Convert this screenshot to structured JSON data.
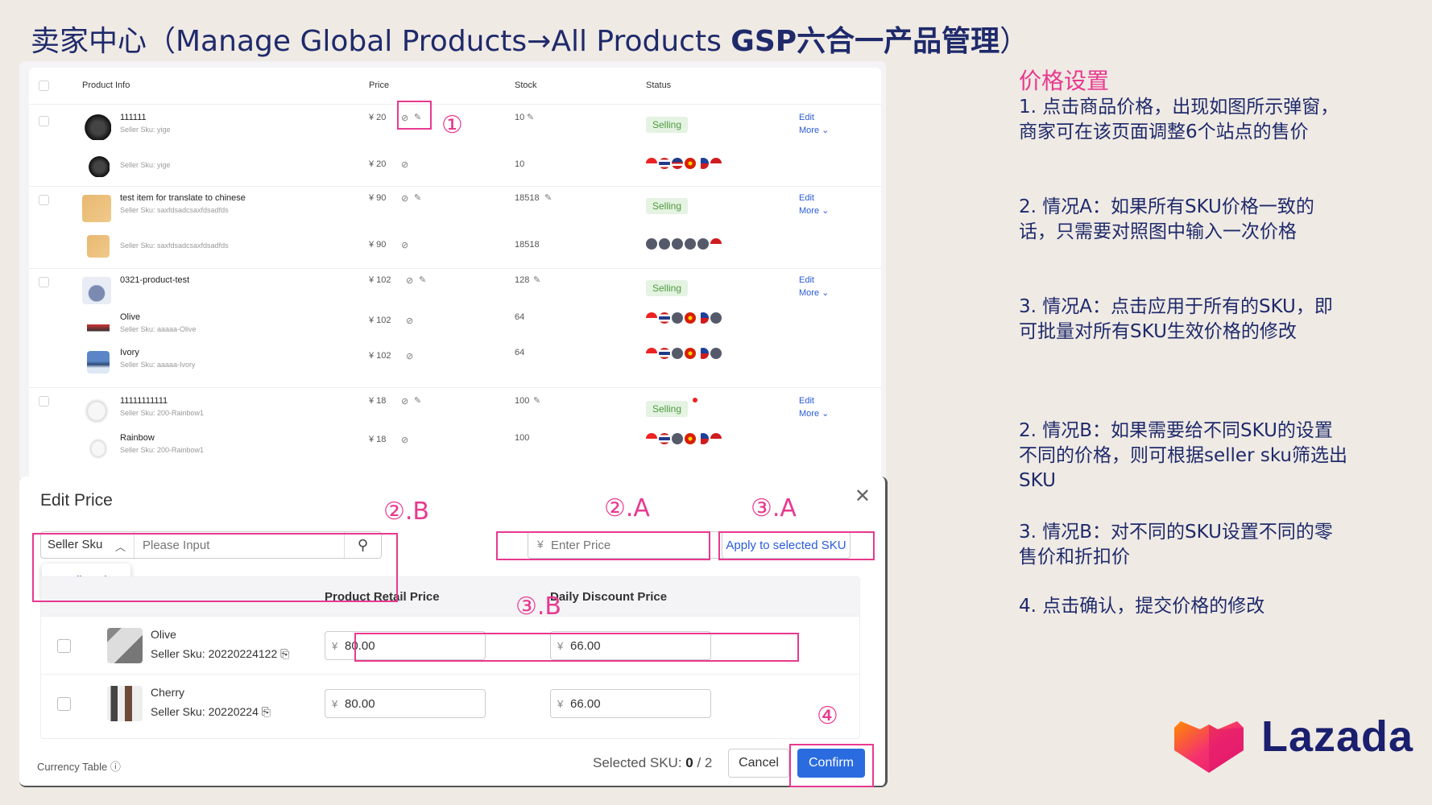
{
  "title": {
    "prefix": "卖家中心（Manage Global Products→All Products ",
    "bold": "GSP六合一产品管理",
    "suffix": "）"
  },
  "list": {
    "headers": [
      "Product Info",
      "Price",
      "Stock",
      "Status"
    ],
    "groups": [
      {
        "main": {
          "name": "111111",
          "sku": "Seller Sku: yige",
          "price": "¥ 20",
          "stock": "10",
          "status": "Selling",
          "edit": "Edit",
          "more": "More"
        },
        "variants": [
          {
            "name": "",
            "sku": "Seller Sku: yige",
            "price": "¥ 20",
            "stock": "10"
          }
        ]
      },
      {
        "main": {
          "name": "test item for translate to chinese",
          "sku": "Seller Sku: saxfdsadcsaxfdsadfds",
          "price": "¥ 90",
          "stock": "18518",
          "status": "Selling",
          "edit": "Edit",
          "more": "More"
        },
        "variants": [
          {
            "name": "",
            "sku": "Seller Sku: saxfdsadcsaxfdsadfds",
            "price": "¥ 90",
            "stock": "18518"
          }
        ]
      },
      {
        "main": {
          "name": "0321-product-test",
          "sku": "",
          "price": "¥ 102",
          "stock": "128",
          "status": "Selling",
          "edit": "Edit",
          "more": "More"
        },
        "variants": [
          {
            "name": "Olive",
            "sku": "Seller Sku: aaaaa-Olive",
            "price": "¥ 102",
            "stock": "64"
          },
          {
            "name": "Ivory",
            "sku": "Seller Sku: aaaaa-Ivory",
            "price": "¥ 102",
            "stock": "64"
          }
        ]
      },
      {
        "main": {
          "name": "11111111111",
          "sku": "Seller Sku: 200-Rainbow1",
          "price": "¥ 18",
          "stock": "100",
          "status": "Selling",
          "edit": "Edit",
          "more": "More"
        },
        "variants": [
          {
            "name": "Rainbow",
            "sku": "Seller Sku: 200-Rainbow1",
            "price": "¥ 18",
            "stock": "100"
          }
        ]
      }
    ]
  },
  "annotations": {
    "one": "①",
    "two_b": "②.B",
    "two_a": "②.A",
    "three_a": "③.A",
    "three_b": "③.B",
    "four": "④"
  },
  "modal": {
    "title": "Edit Price",
    "close": "✕",
    "search_select": "Seller Sku",
    "search_placeholder": "Please Input",
    "dropdown_option": "Seller Sku",
    "price_yen": "¥",
    "price_placeholder": "Enter Price",
    "apply_label": "Apply to selected SKU",
    "col_retail": "Product Retail Price",
    "col_discount": "Daily Discount Price",
    "rows": [
      {
        "name": "Olive",
        "sku": "Seller Sku: 20220224122",
        "retail": "80.00",
        "discount": "66.00"
      },
      {
        "name": "Cherry",
        "sku": "Seller Sku: 20220224",
        "retail": "80.00",
        "discount": "66.00"
      }
    ],
    "currency_table": "Currency Table",
    "selected_prefix": "Selected SKU: ",
    "selected_count": "0",
    "selected_total": " / 2",
    "cancel": "Cancel",
    "confirm": "Confirm"
  },
  "instructions": {
    "title": "价格设置",
    "steps": [
      "1.   点击商品价格，出现如图所示弹窗，商家可在该页面调整6个站点的售价",
      "2.   情况A：如果所有SKU价格一致的话，只需要对照图中输入一次价格",
      "3.   情况A：点击应用于所有的SKU，即可批量对所有SKU生效价格的修改",
      "2.   情况B：如果需要给不同SKU的设置不同的价格，则可根据seller sku筛选出SKU",
      "3.   情况B：对不同的SKU设置不同的零售价和折扣价",
      "4.   点击确认，提交价格的修改"
    ]
  },
  "logo": {
    "text": "Lazada"
  },
  "colors": {
    "accent_pink": "#e8398f",
    "primary_blue": "#2a6be0",
    "title_navy": "#1f2a6b",
    "selling_green": "#4f9a3f"
  }
}
